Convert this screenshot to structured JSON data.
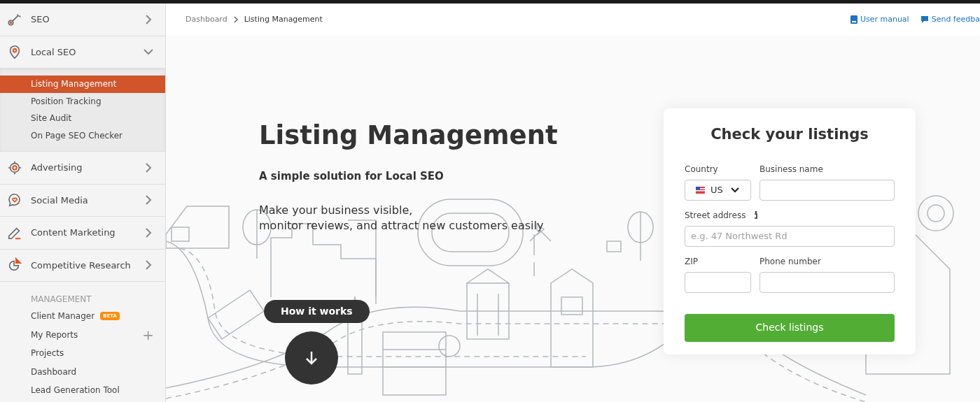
{
  "sidebar": {
    "items": [
      {
        "label": "SEO",
        "expanded": false
      },
      {
        "label": "Local SEO",
        "expanded": true,
        "children": [
          {
            "label": "Listing Management",
            "selected": true
          },
          {
            "label": "Position Tracking",
            "selected": false
          },
          {
            "label": "Site Audit",
            "selected": false
          },
          {
            "label": "On Page SEO Checker",
            "selected": false
          }
        ]
      },
      {
        "label": "Advertising",
        "expanded": false
      },
      {
        "label": "Social Media",
        "expanded": false
      },
      {
        "label": "Content Marketing",
        "expanded": false
      },
      {
        "label": "Competitive Research",
        "expanded": false
      }
    ],
    "management": {
      "heading": "MANAGEMENT",
      "items": [
        {
          "label": "Client Manager",
          "badge": "BETA"
        },
        {
          "label": "My Reports",
          "add": "+"
        },
        {
          "label": "Projects"
        },
        {
          "label": "Dashboard"
        },
        {
          "label": "Lead Generation Tool"
        }
      ]
    }
  },
  "breadcrumb": [
    "Dashboard",
    "Listing Management"
  ],
  "top_links": [
    {
      "label": "User manual"
    },
    {
      "label": "Send feedba"
    }
  ],
  "hero": {
    "title": "Listing Management",
    "subtitle": "A simple solution for Local SEO",
    "description": [
      "Make your business visible,",
      "monitor reviews, and attract new customers easily"
    ],
    "how_it_works": "How it works"
  },
  "form": {
    "title": "Check your listings",
    "country_label": "Country",
    "country_value": "US",
    "business_label": "Business name",
    "street_label": "Street address",
    "street_placeholder": "e.g. 47 Northwest Rd",
    "zip_label": "ZIP",
    "phone_label": "Phone number",
    "submit": "Check listings"
  }
}
